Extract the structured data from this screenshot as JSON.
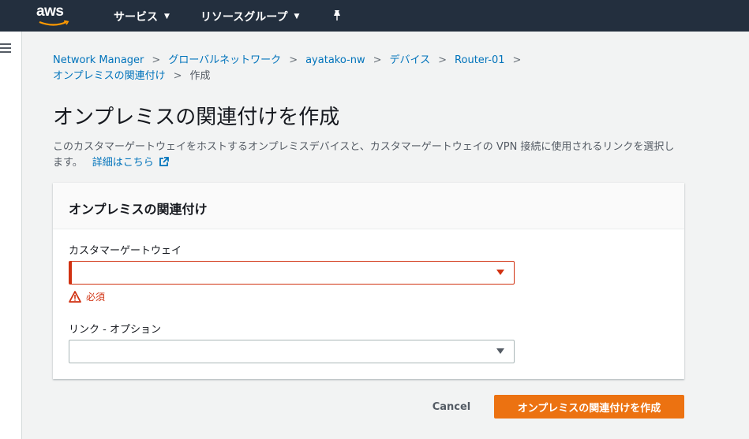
{
  "topnav": {
    "logo_text": "aws",
    "services_label": "サービス",
    "resource_groups_label": "リソースグループ"
  },
  "breadcrumb": {
    "items": [
      "Network Manager",
      "グローバルネットワーク",
      "ayatako-nw",
      "デバイス",
      "Router-01",
      "オンプレミスの関連付け"
    ],
    "current": "作成"
  },
  "page": {
    "title": "オンプレミスの関連付けを作成",
    "description": "このカスタマーゲートウェイをホストするオンプレミスデバイスと、カスタマーゲートウェイの VPN 接続に使用されるリンクを選択します。",
    "learn_more": "詳細はこちら"
  },
  "panel": {
    "header": "オンプレミスの関連付け",
    "customer_gateway_label": "カスタマーゲートウェイ",
    "customer_gateway_value": "",
    "error_text": "必須",
    "link_label": "リンク - オプション",
    "link_value": ""
  },
  "actions": {
    "cancel_label": "Cancel",
    "create_label": "オンプレミスの関連付けを作成"
  },
  "colors": {
    "nav_bg": "#232f3e",
    "primary": "#ec7211",
    "link": "#0073bb",
    "error": "#d13212"
  }
}
